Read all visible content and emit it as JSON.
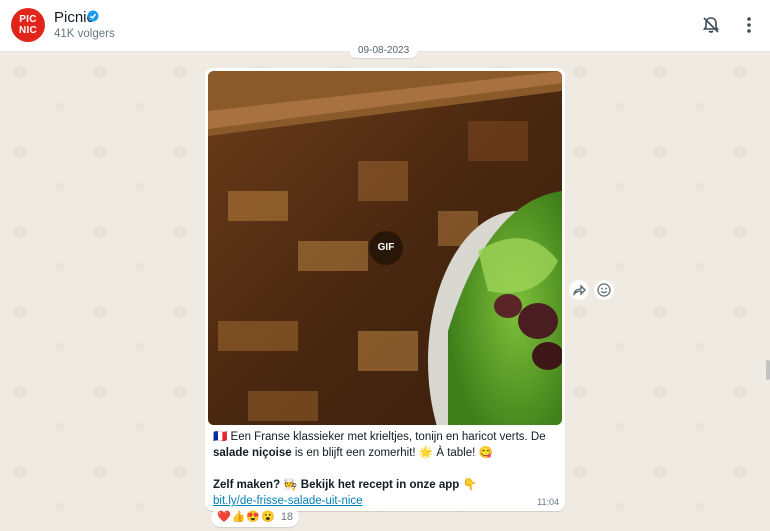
{
  "header": {
    "avatar_text": "PIC NIC",
    "channel_name": "Picnic",
    "followers": "41K volgers",
    "verified_icon": "verified-badge-icon",
    "mute_icon": "bell-off-icon",
    "menu_icon": "more-vertical-icon"
  },
  "date_chip": "09-08-2023",
  "message": {
    "gif_label": "GIF",
    "line1_flag": "🇫🇷",
    "line1_a": " Een Franse klassieker met krieltjes, tonijn en haricot verts. De ",
    "line1_bold": "salade niçoise",
    "line1_b": " is en blijft een zomerhit! 🌟 À table! 😋",
    "line2_bold": "Zelf maken? 🧑‍🍳 Bekijk het recept in onze app",
    "line2_emoji": " 👇",
    "link": "bit.ly/de-frisse-salade-uit-nice",
    "time": "11:04"
  },
  "reactions": {
    "emojis": [
      "❤️",
      "👍",
      "😍",
      "😮"
    ],
    "count": "18"
  },
  "actions": {
    "forward_icon": "forward-icon",
    "emoji_icon": "smiley-icon"
  },
  "colors": {
    "header_bg": "#ffffff",
    "chat_bg": "#efeae2",
    "link": "#027eb5",
    "brand": "#e1251b",
    "verified": "#1d9bf0"
  }
}
